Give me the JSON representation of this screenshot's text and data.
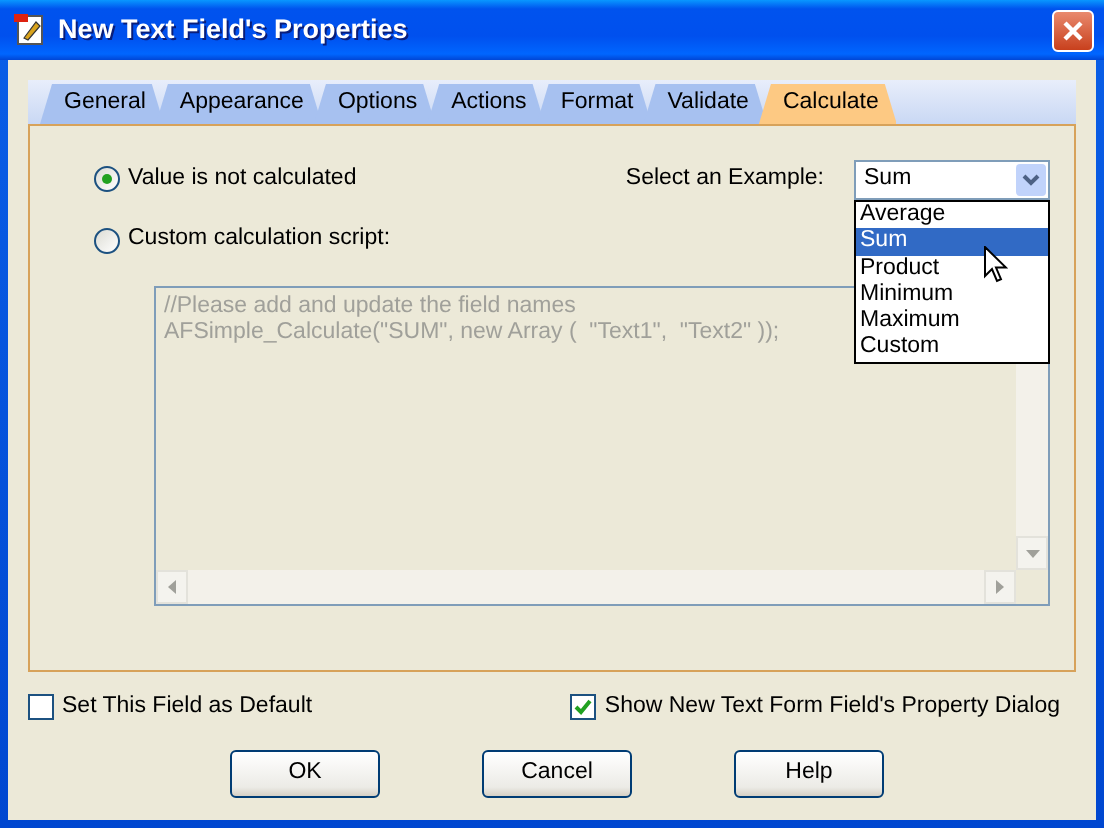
{
  "window": {
    "title": "New Text Field's Properties"
  },
  "tabs": [
    {
      "label": "General",
      "selected": false
    },
    {
      "label": "Appearance",
      "selected": false
    },
    {
      "label": "Options",
      "selected": false
    },
    {
      "label": "Actions",
      "selected": false
    },
    {
      "label": "Format",
      "selected": false
    },
    {
      "label": "Validate",
      "selected": false
    },
    {
      "label": "Calculate",
      "selected": true
    }
  ],
  "calc_options": [
    {
      "label": "Value is not calculated",
      "selected": true
    },
    {
      "label": "Custom calculation script:",
      "selected": false
    }
  ],
  "example_select": {
    "label": "Select an Example:",
    "value": "Sum",
    "expanded": true,
    "options": [
      {
        "label": "Average",
        "selected": false
      },
      {
        "label": "Sum",
        "selected": true
      },
      {
        "label": "Product",
        "selected": false
      },
      {
        "label": "Minimum",
        "selected": false
      },
      {
        "label": "Maximum",
        "selected": false
      },
      {
        "label": "Custom",
        "selected": false
      }
    ]
  },
  "script": {
    "disabled": true,
    "lines": [
      "//Please add and update the field names",
      "AFSimple_Calculate(\"SUM\", new Array (  \"Text1\",  \"Text2\" ));"
    ]
  },
  "checkboxes": [
    {
      "label": "Set This Field as Default",
      "checked": false
    },
    {
      "label": "Show New Text Form Field's Property Dialog",
      "checked": true
    }
  ],
  "buttons": [
    "OK",
    "Cancel",
    "Help"
  ]
}
